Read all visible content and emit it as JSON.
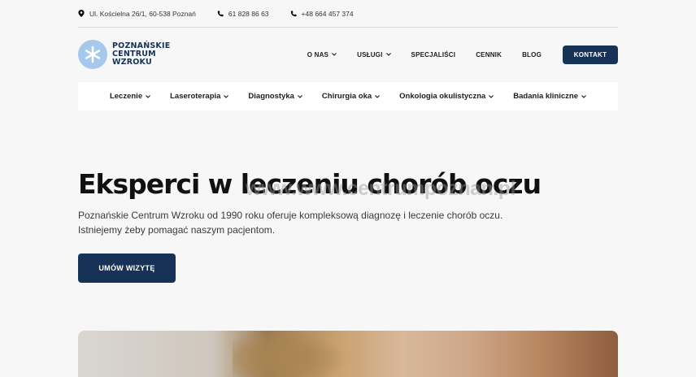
{
  "topbar": {
    "address": "Ul. Kościelna 26/1, 60-538 Poznań",
    "phone1": "61 828 86 63",
    "phone2": "+48 664 457 374"
  },
  "logo": {
    "line1": "POZNAŃSKIE",
    "line2": "CENTRUM",
    "line3": "WZROKU"
  },
  "mainnav": {
    "items": [
      "O NAS",
      "USŁUGI",
      "SPECJALIŚCI",
      "CENNIK",
      "BLOG"
    ],
    "contact": "KONTAKT"
  },
  "subnav": {
    "items": [
      "Leczenie",
      "Laseroterapia",
      "Diagnostyka",
      "Chirurgia oka",
      "Onkologia okulistyczna",
      "Badania kliniczne"
    ]
  },
  "hero": {
    "title": "Eksperci w leczeniu chorób oczu",
    "watermark": "www.www.centrumpoznan.pl",
    "description": "Poznańskie Centrum Wzroku od 1990 roku oferuje kompleksową diagnozę i leczenie chorób oczu. Istniejemy żeby pomagać naszym pacjentom.",
    "cta": "UMÓW WIZYTĘ"
  },
  "colors": {
    "brand": "#163257",
    "logo_circle": "#a6c8ec",
    "background": "#f7f7f7"
  }
}
